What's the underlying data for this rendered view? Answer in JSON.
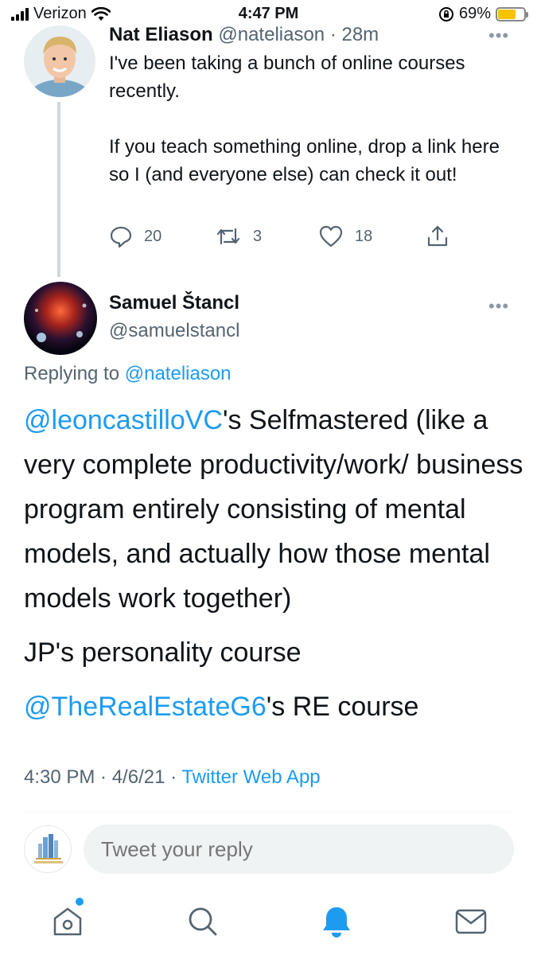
{
  "status_bar": {
    "carrier": "Verizon",
    "time": "4:47 PM",
    "battery_pct": "69%",
    "battery_level": 0.69,
    "icons": [
      "signal-icon",
      "wifi-icon",
      "orientation-lock-icon",
      "battery-icon"
    ]
  },
  "parent_tweet": {
    "name": "Nat Eliason",
    "handle": "@nateliason",
    "time": "· 28m",
    "paragraph1": "I've been taking a bunch of online courses recently.",
    "paragraph2": "If you teach something online, drop a link here so I (and everyone else) can check it out!",
    "replies": "20",
    "retweets": "3",
    "likes": "18",
    "more": "•••"
  },
  "reply_tweet": {
    "name": "Samuel Štancl",
    "handle": "@samuelstancl",
    "more": "•••",
    "replying_label": "Replying to",
    "replying_handle": "@nateliason",
    "p1_mention": "@leoncastilloVC",
    "p1_text": "'s Selfmastered (like a very complete productivity/work/ business program entirely consisting of mental models, and actually how those mental models work together)",
    "p2_text": "JP's personality course",
    "p3_mention": "@TheRealEstateG6",
    "p3_text": "'s RE course",
    "timestamp": "4:30 PM · 4/6/21 · ",
    "source": "Twitter Web App"
  },
  "composer": {
    "placeholder": "Tweet your reply"
  },
  "colors": {
    "link": "#1d9bf0",
    "muted": "#536471",
    "battery": "#f6c300"
  }
}
